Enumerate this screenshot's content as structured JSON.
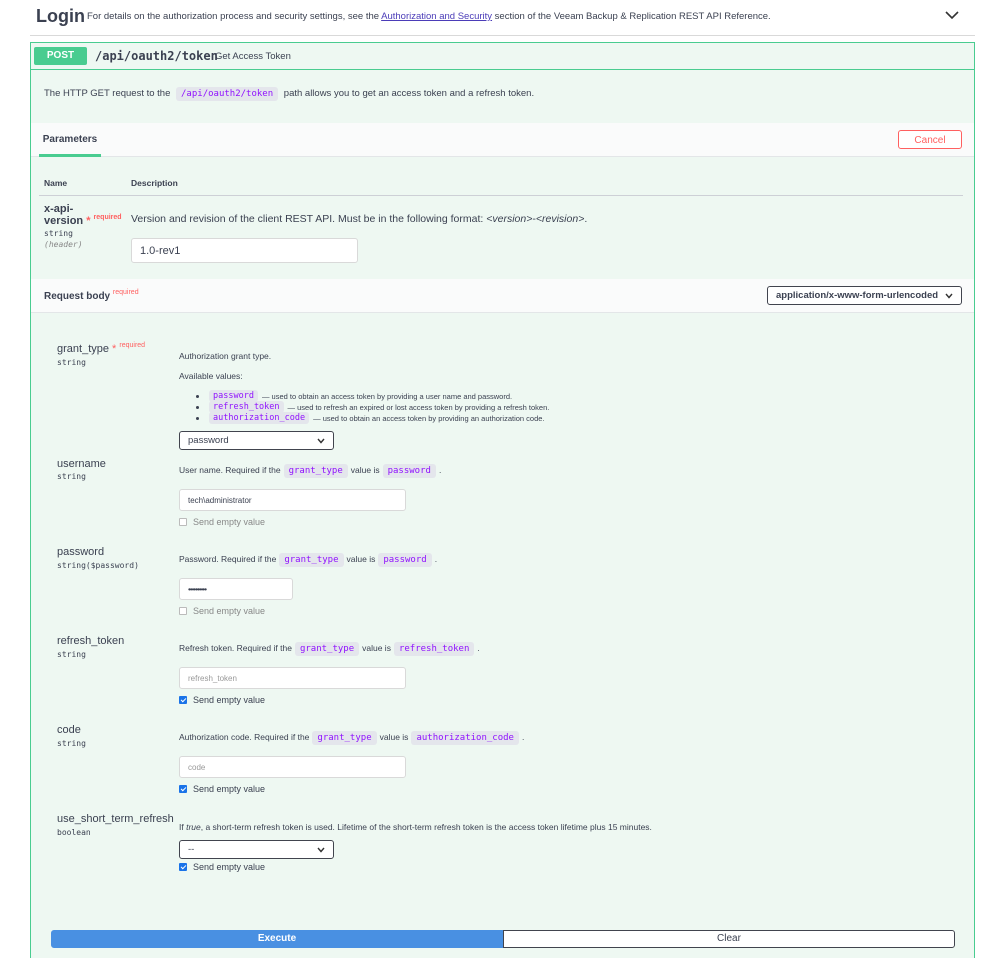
{
  "header": {
    "title": "Login",
    "desc_prefix": "For details on the authorization process and security settings, see the ",
    "desc_link": "Authorization and Security",
    "desc_suffix": " section of the Veeam Backup & Replication REST API Reference."
  },
  "operation": {
    "method": "POST",
    "path": "/api/oauth2/token",
    "summary": "Get Access Token",
    "desc_prefix": "The HTTP GET request to the",
    "desc_code": "/api/oauth2/token",
    "desc_suffix": "path allows you to get an access token and a refresh token."
  },
  "parameters": {
    "tab_label": "Parameters",
    "cancel_label": "Cancel",
    "col_name": "Name",
    "col_description": "Description",
    "items": [
      {
        "name_line1": "x-api-",
        "name_line2": "version",
        "star": "*",
        "required": "required",
        "type": "string",
        "in": "(header)",
        "desc_prefix": "Version and revision of the client REST API. Must be in the following format: ",
        "desc_version": "<version>",
        "desc_dash": "-",
        "desc_revision": "<revision>",
        "desc_end": ".",
        "value": "1.0-rev1"
      }
    ]
  },
  "request_body": {
    "label": "Request body",
    "required": "required",
    "content_type": "application/x-www-form-urlencoded",
    "fields": {
      "grant_type": {
        "name": "grant_type",
        "star": "*",
        "required": "required",
        "type": "string",
        "desc": "Authorization grant type.",
        "available_label": "Available values:",
        "options": [
          {
            "code": "password",
            "text": "— used to obtain an access token by providing a user name and password."
          },
          {
            "code": "refresh_token",
            "text": "— used to refresh an expired or lost access token by providing a refresh token."
          },
          {
            "code": "authorization_code",
            "text": "— used to obtain an access token by providing an authorization code."
          }
        ],
        "selected": "password"
      },
      "username": {
        "name": "username",
        "type": "string",
        "desc_prefix": "User name. Required if the",
        "desc_code1": "grant_type",
        "desc_mid": "value is",
        "desc_code2": "password",
        "desc_end": ".",
        "value": "tech\\administrator",
        "send_empty": "Send empty value",
        "send_empty_checked": false
      },
      "password": {
        "name": "password",
        "type": "string($password)",
        "desc_prefix": "Password. Required if the",
        "desc_code1": "grant_type",
        "desc_mid": "value is",
        "desc_code2": "password",
        "desc_end": ".",
        "value": "••••••••••",
        "send_empty": "Send empty value",
        "send_empty_checked": false
      },
      "refresh_token": {
        "name": "refresh_token",
        "type": "string",
        "desc_prefix": "Refresh token. Required if the",
        "desc_code1": "grant_type",
        "desc_mid": "value is",
        "desc_code2": "refresh_token",
        "desc_end": ".",
        "placeholder": "refresh_token",
        "send_empty": "Send empty value",
        "send_empty_checked": true
      },
      "code": {
        "name": "code",
        "type": "string",
        "desc_prefix": "Authorization code. Required if the",
        "desc_code1": "grant_type",
        "desc_mid": "value is",
        "desc_code2": "authorization_code",
        "desc_end": ".",
        "placeholder": "code",
        "send_empty": "Send empty value",
        "send_empty_checked": true
      },
      "use_short_term_refresh": {
        "name": "use_short_term_refresh",
        "type": "boolean",
        "desc_prefix": "If ",
        "desc_em": "true",
        "desc_suffix": ", a short-term refresh token is used. Lifetime of the short-term refresh token is the access token lifetime plus 15 minutes.",
        "selected": "--",
        "send_empty": "Send empty value",
        "send_empty_checked": true
      }
    }
  },
  "actions": {
    "execute": "Execute",
    "clear": "Clear"
  },
  "colors": {
    "post_green": "#49cc90",
    "execute_blue": "#4990e2",
    "required_red": "#ff6060",
    "code_purple": "#9012fe"
  }
}
